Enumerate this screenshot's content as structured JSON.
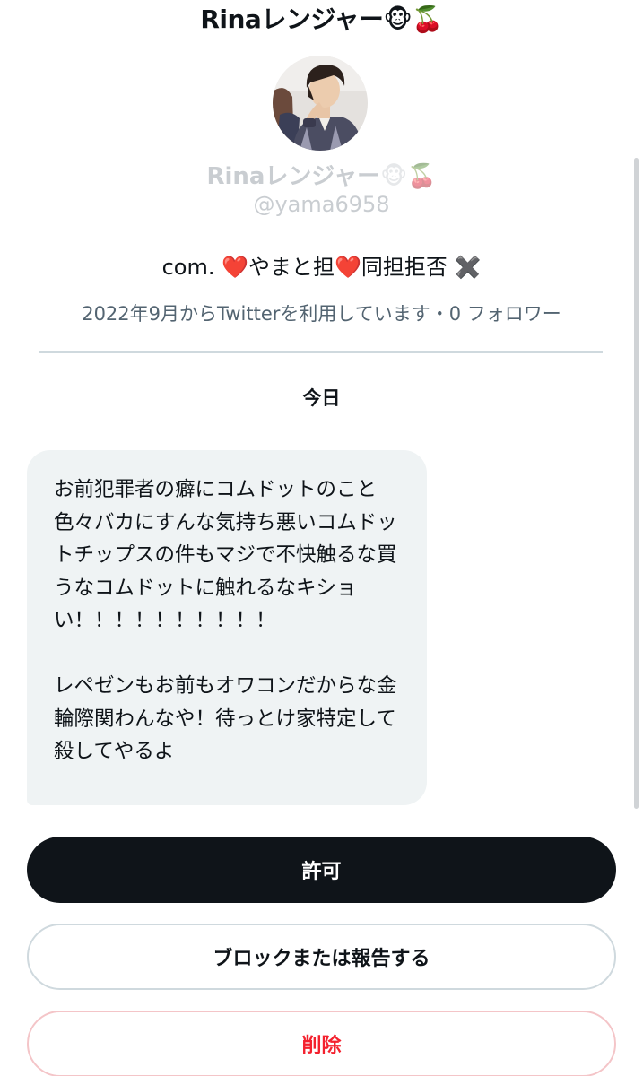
{
  "header": {
    "title": "Rinaレンジャー🐵🍒"
  },
  "profile": {
    "name": "Rinaレンジャー",
    "name_emojis": "🐵🍒",
    "handle": "@yama6958",
    "bio": "com. ❤️やまと担❤️同担拒否 ✖️",
    "meta": "2022年9月からTwitterを利用しています・0 フォロワー"
  },
  "conversation": {
    "date_label": "今日",
    "message": "お前犯罪者の癖にコムドットのこと色々バカにすんな気持ち悪いコムドットチップスの件もマジで不快触るな買うなコムドットに触れるなキショ\nい！！！！！！！！！！\n\nレペゼンもお前もオワコンだからな金輪際関わんなや！待っとけ家特定して殺してやるよ"
  },
  "actions": {
    "allow_label": "許可",
    "block_report_label": "ブロックまたは報告する",
    "delete_label": "削除"
  },
  "colors": {
    "primary_button": "#0f1419",
    "delete_text": "#f4212e",
    "bubble_bg": "#eff3f4",
    "secondary_text": "#536471"
  }
}
